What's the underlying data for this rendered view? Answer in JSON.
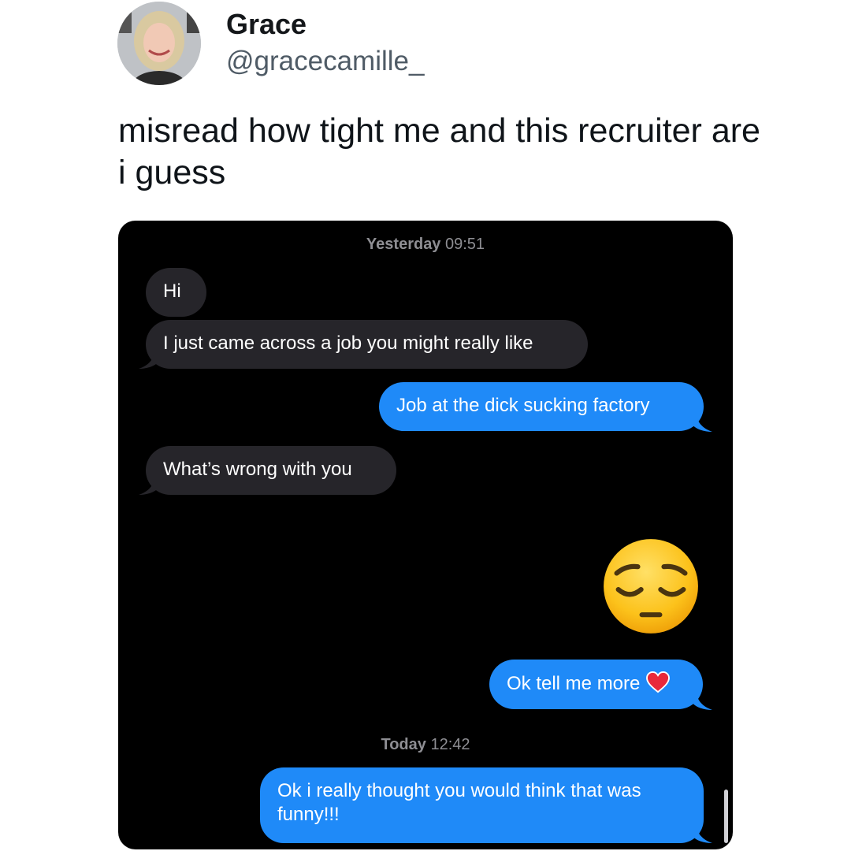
{
  "tweet": {
    "display_name": "Grace",
    "handle": "@gracecamille_",
    "text": "misread how tight me and this recruiter are i guess"
  },
  "conversation": {
    "timestamps": [
      {
        "day": "Yesterday",
        "time": "09:51"
      },
      {
        "day": "Today",
        "time": "12:42"
      }
    ],
    "messages": [
      {
        "direction": "incoming",
        "text": "Hi"
      },
      {
        "direction": "incoming",
        "text": "I just came across a job you might really like"
      },
      {
        "direction": "outgoing",
        "text": "Job at the dick sucking factory"
      },
      {
        "direction": "incoming",
        "text": "What’s wrong with you"
      },
      {
        "direction": "outgoing",
        "type": "emoji",
        "emoji": "pensive-face"
      },
      {
        "direction": "outgoing",
        "text": "Ok tell me more",
        "trailing_emoji": "red-heart"
      },
      {
        "direction": "outgoing",
        "text": "Ok i really thought you would think that was funny!!!"
      }
    ]
  },
  "colors": {
    "incoming_bubble": "#26252a",
    "outgoing_bubble": "#1f8af8",
    "background": "#000000"
  }
}
